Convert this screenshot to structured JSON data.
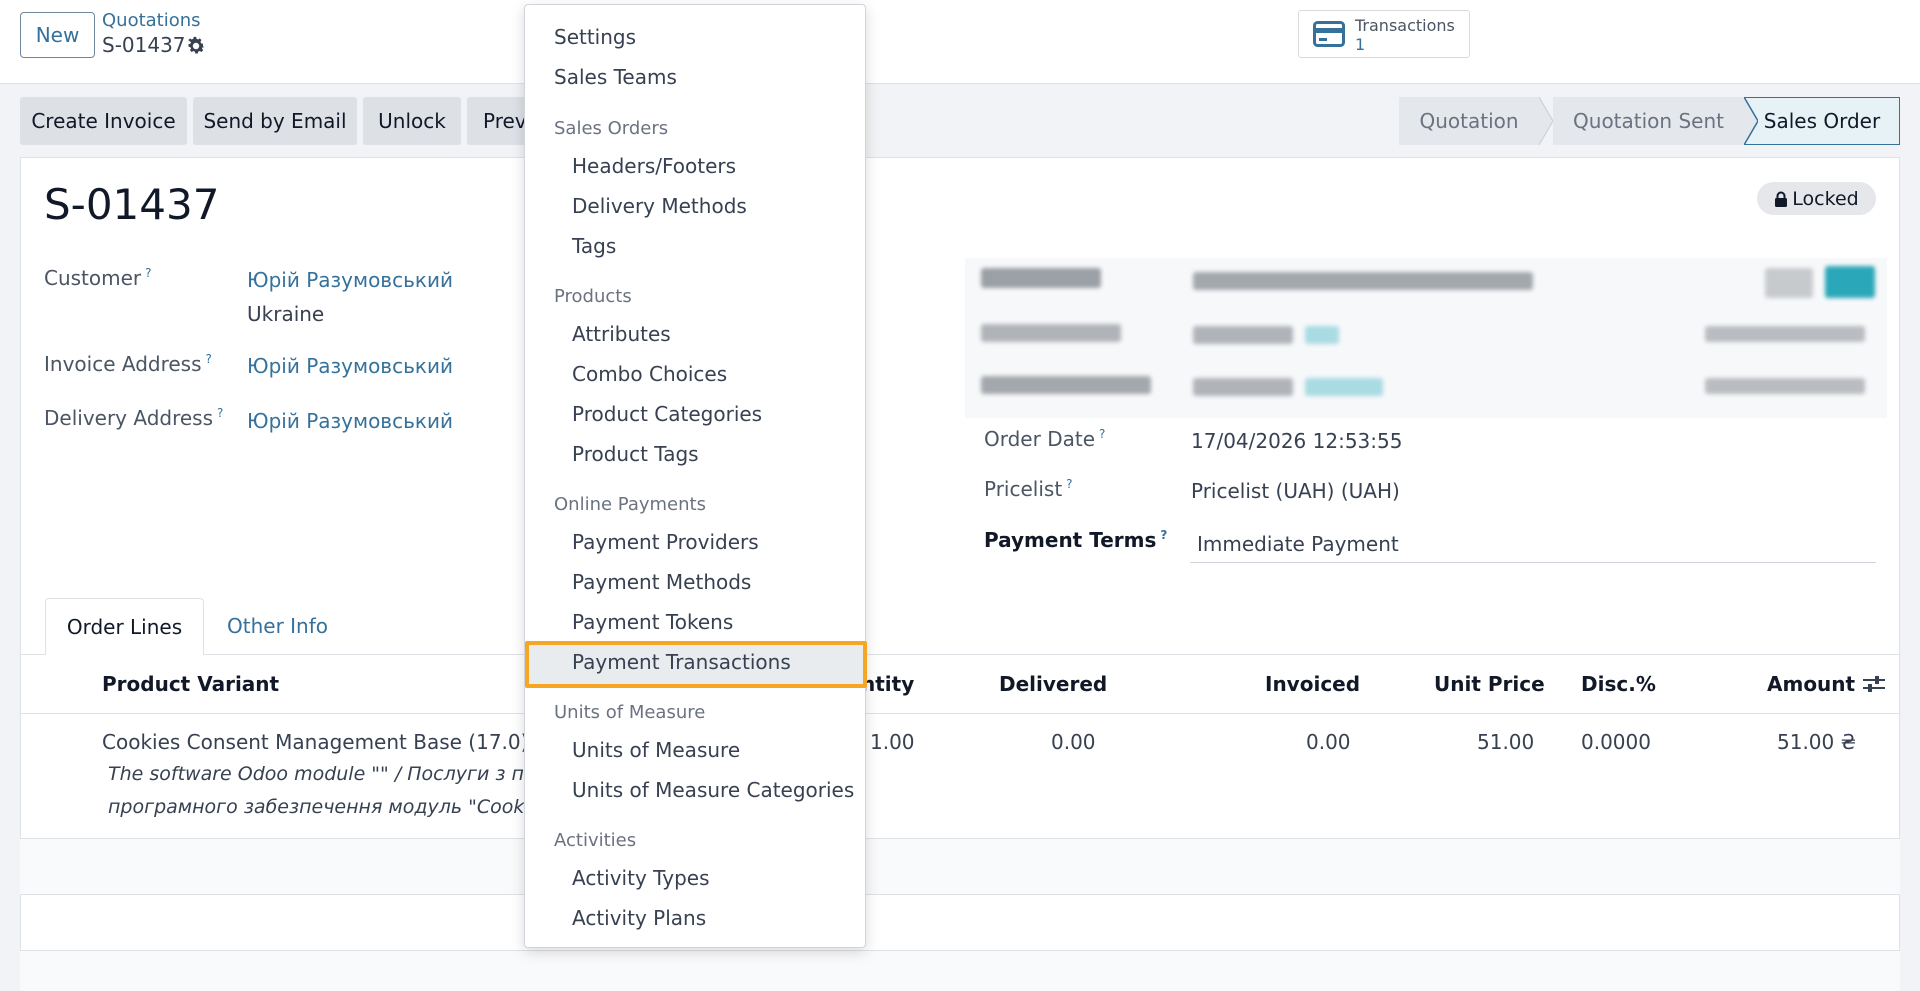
{
  "header": {
    "new_label": "New",
    "breadcrumb_parent": "Quotations",
    "breadcrumb_current": "S-01437",
    "smart_button": {
      "label": "Transactions",
      "value": "1"
    }
  },
  "actions": {
    "create_invoice": "Create Invoice",
    "send_email": "Send by Email",
    "unlock": "Unlock",
    "preview": "Prev"
  },
  "status": {
    "steps": [
      "Quotation",
      "Quotation Sent",
      "Sales Order"
    ],
    "active": "Sales Order"
  },
  "form": {
    "name": "S-01437",
    "locked_badge": "Locked",
    "customer_label": "Customer",
    "customer_value": "Юрій Разумовський",
    "customer_country": "Ukraine",
    "invoice_address_label": "Invoice Address",
    "invoice_address_value": "Юрій Разумовський",
    "delivery_address_label": "Delivery Address",
    "delivery_address_value": "Юрій Разумовський",
    "order_date_label": "Order Date",
    "order_date_value": "17/04/2026 12:53:55",
    "pricelist_label": "Pricelist",
    "pricelist_value": "Pricelist (UAH) (UAH)",
    "payment_terms_label": "Payment Terms",
    "payment_terms_value": "Immediate Payment",
    "help_mark": "?"
  },
  "tabs": {
    "order_lines": "Order Lines",
    "other_info": "Other Info"
  },
  "table": {
    "headers": {
      "product": "Product Variant",
      "quantity": "ntity",
      "delivered": "Delivered",
      "invoiced": "Invoiced",
      "unit_price": "Unit Price",
      "disc": "Disc.%",
      "amount": "Amount"
    },
    "rows": [
      {
        "product": "Cookies Consent Management Base (17.0)",
        "desc_line1": "The software Odoo module \"\" / Послуги з посл",
        "desc_line2": "програмного забезпечення модуль \"Cookies C",
        "quantity": "1.00",
        "delivered": "0.00",
        "invoiced": "0.00",
        "unit_price": "51.00",
        "disc": "0.0000",
        "amount": "51.00 ₴"
      }
    ]
  },
  "menu": {
    "settings": "Settings",
    "sales_teams": "Sales Teams",
    "sales_orders_header": "Sales Orders",
    "headers_footers": "Headers/Footers",
    "delivery_methods": "Delivery Methods",
    "tags": "Tags",
    "products_header": "Products",
    "attributes": "Attributes",
    "combo_choices": "Combo Choices",
    "product_categories": "Product Categories",
    "product_tags": "Product Tags",
    "online_payments_header": "Online Payments",
    "payment_providers": "Payment Providers",
    "payment_methods": "Payment Methods",
    "payment_tokens": "Payment Tokens",
    "payment_transactions": "Payment Transactions",
    "uom_header": "Units of Measure",
    "units_of_measure": "Units of Measure",
    "uom_categories": "Units of Measure Categories",
    "activities_header": "Activities",
    "activity_types": "Activity Types",
    "activity_plans": "Activity Plans"
  },
  "colors": {
    "link": "#35719a",
    "highlight_border": "#f5a623",
    "accent_teal": "#2aa7b8"
  }
}
